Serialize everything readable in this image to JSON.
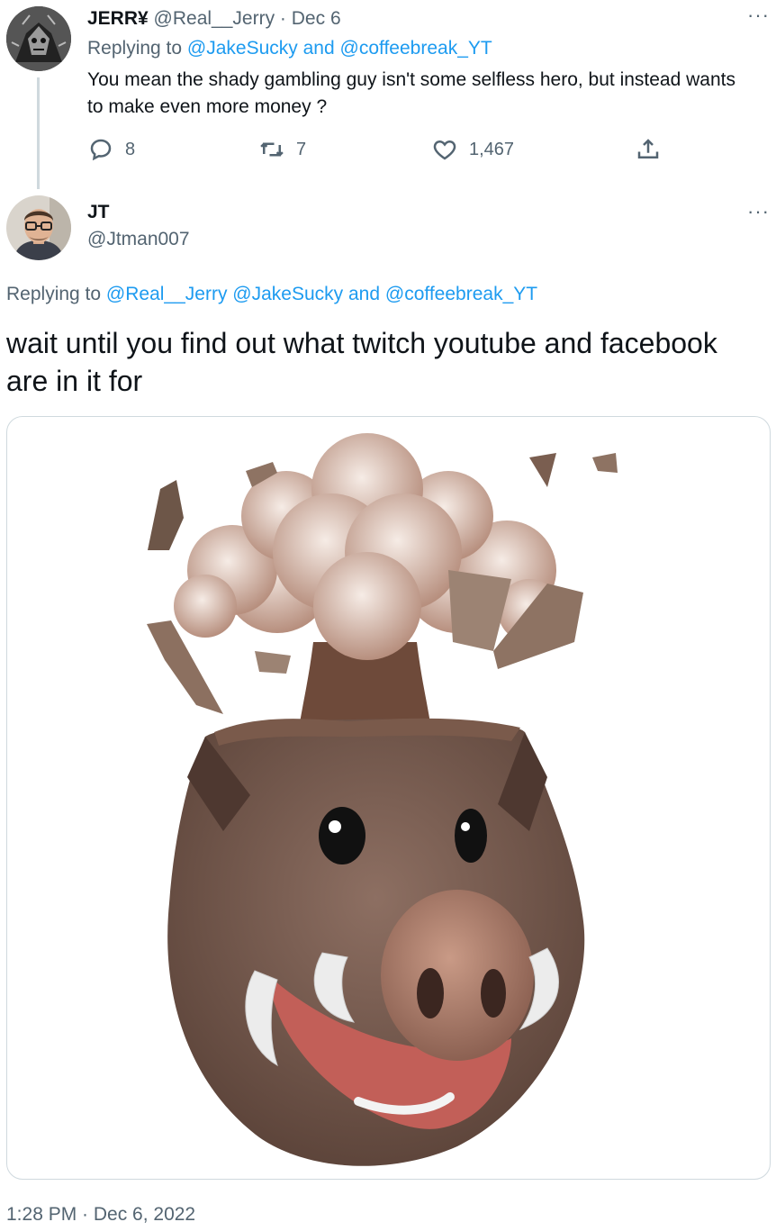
{
  "parent_tweet": {
    "display_name": "JERR¥",
    "handle": "@Real__Jerry",
    "separator": "·",
    "date": "Dec 6",
    "replying_prefix": "Replying to",
    "replying_to_1": "@JakeSucky",
    "replying_and": "and",
    "replying_to_2": "@coffeebreak_YT",
    "text": "You mean the shady gambling guy isn't some selfless hero, but instead wants to make even more money ?",
    "reply_count": "8",
    "retweet_count": "7",
    "like_count": "1,467",
    "more_label": "···"
  },
  "main_tweet": {
    "display_name": "JT",
    "handle": "@Jtman007",
    "replying_prefix": "Replying to",
    "replying_to_1": "@Real__Jerry",
    "replying_to_2": "@JakeSucky",
    "replying_and": "and",
    "replying_to_3": "@coffeebreak_YT",
    "text": "wait until you find out what twitch youtube and facebook are in it for",
    "timestamp": "1:28 PM · Dec 6, 2022",
    "more_label": "···",
    "media_description_icon": "mind-blown-boar-memoji"
  },
  "icons": {
    "reply": "reply-icon",
    "retweet": "retweet-icon",
    "like": "heart-icon",
    "share": "share-icon",
    "more": "more-icon"
  },
  "colors": {
    "link": "#1d9bf0",
    "muted": "#536471",
    "text": "#0f1419",
    "border": "#cfd9de"
  }
}
